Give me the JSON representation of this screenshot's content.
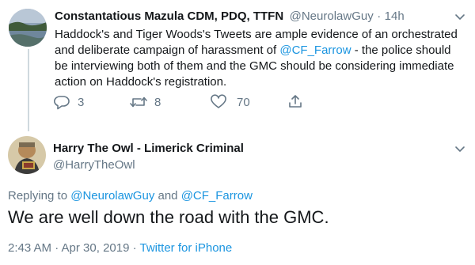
{
  "tweet1": {
    "name": "Constantatious Mazula CDM, PDQ, TTFN",
    "handle": "@NeurolawGuy",
    "sep": "·",
    "time": "14h",
    "text_before": "Haddock's and Tiger Woods's Tweets are ample evidence of an orchestrated and deliberate campaign of harassment of ",
    "mention": "@CF_Farrow",
    "text_after": " - the police should be interviewing both of them and the GMC should be considering immediate action on Haddock's registration.",
    "replies": "3",
    "retweets": "8",
    "likes": "70",
    "icons": [
      "reply-icon",
      "retweet-icon",
      "like-icon",
      "share-icon",
      "chevron-down-icon"
    ]
  },
  "tweet2": {
    "name": "Harry The Owl - Limerick Criminal",
    "handle": "@HarryTheOwl",
    "replying_prefix": "Replying to ",
    "replying_user1": "@NeurolawGuy",
    "replying_and": " and ",
    "replying_user2": "@CF_Farrow",
    "text": "We are well down the road with the GMC.",
    "timestamp": "2:43 AM · Apr 30, 2019",
    "sep": " · ",
    "source": "Twitter for iPhone"
  },
  "colors": {
    "text": "#14171a",
    "muted": "#657786",
    "link": "#1b95e0",
    "line": "#cfd9de"
  }
}
